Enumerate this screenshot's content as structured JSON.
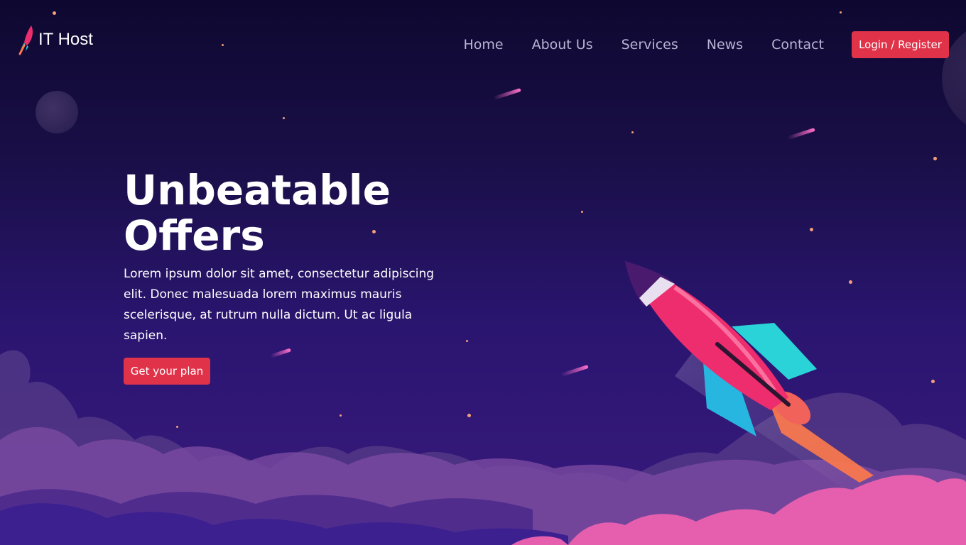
{
  "brand": {
    "name": "IT Host",
    "logo_icon": "rocket-icon"
  },
  "nav": {
    "items": [
      {
        "label": "Home"
      },
      {
        "label": "About Us"
      },
      {
        "label": "Services"
      },
      {
        "label": "News"
      },
      {
        "label": "Contact"
      }
    ],
    "login_label": "Login / Register"
  },
  "hero": {
    "title_line1": "Unbeatable",
    "title_line2": "Offers",
    "description": "Lorem ipsum dolor sit amet, consectetur adipiscing elit. Donec malesuada lorem maximus mauris scelerisque, at rutrum nulla dictum. Ut ac ligula sapien.",
    "cta_label": "Get your plan",
    "illustration": "rocket-illustration"
  },
  "colors": {
    "accent": "#e0334a",
    "background_top": "#0e0830",
    "background_bottom": "#3a1a7e",
    "nav_text": "#b9b4d4",
    "rocket_body": "#ee2d6e",
    "rocket_fins": "#2ad3d8"
  }
}
